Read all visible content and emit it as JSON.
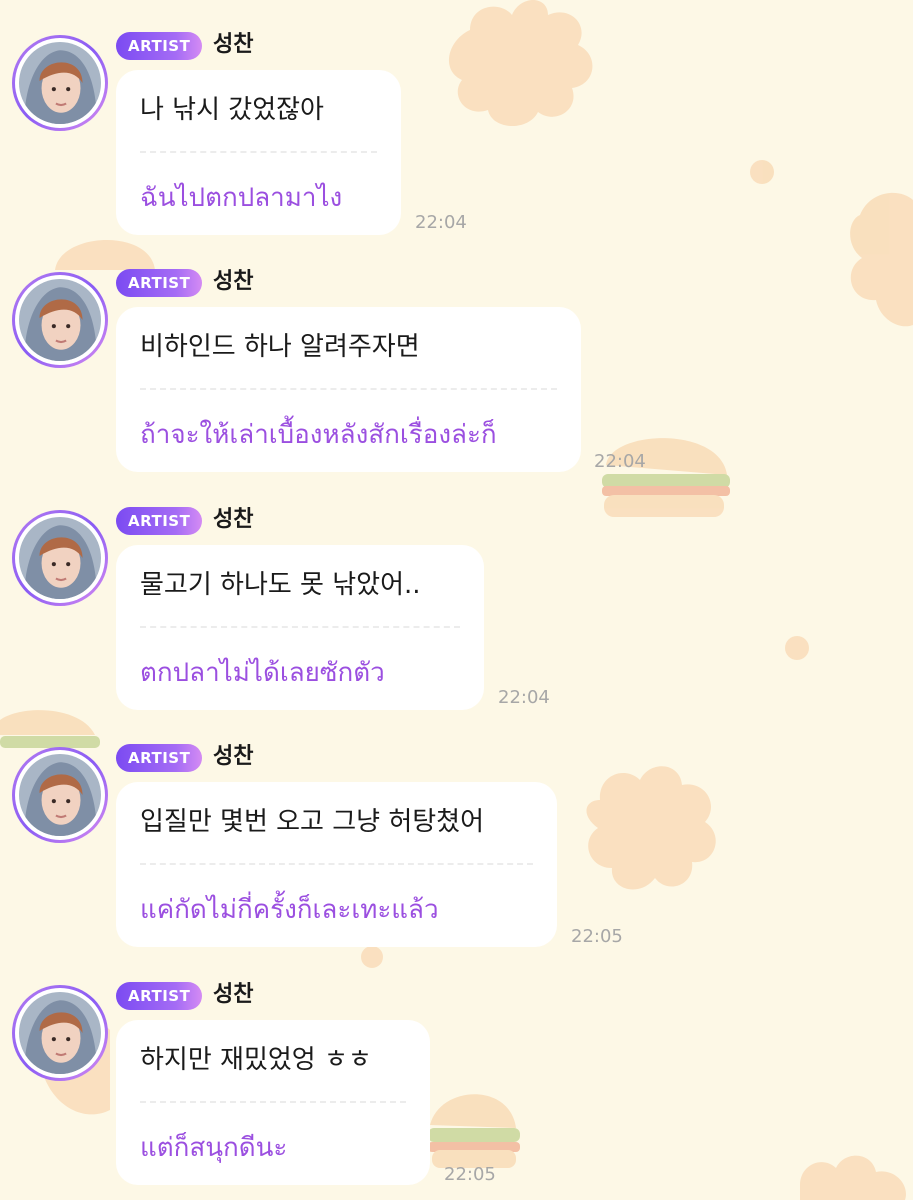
{
  "colors": {
    "background": "#fdf8e6",
    "badge_gradient_start": "#7b4bf2",
    "badge_gradient_end": "#d48bf3",
    "translation_text": "#9b4fe0",
    "timestamp": "#a7a7a7"
  },
  "messages": [
    {
      "badge": "ARTIST",
      "sender": "성찬",
      "avatar": "artist-avatar",
      "text": "나 낚시 갔었잖아",
      "translation": "ฉันไปตกปลามาไง",
      "time": "22:04"
    },
    {
      "badge": "ARTIST",
      "sender": "성찬",
      "avatar": "artist-avatar",
      "text": "비하인드 하나 알려주자면",
      "translation": "ถ้าจะให้เล่าเบื้องหลังสักเรื่องล่ะก็",
      "time": "22:04"
    },
    {
      "badge": "ARTIST",
      "sender": "성찬",
      "avatar": "artist-avatar",
      "text": "물고기 하나도 못 낚았어..",
      "translation": "ตกปลาไม่ได้เลยซักตัว",
      "time": "22:04"
    },
    {
      "badge": "ARTIST",
      "sender": "성찬",
      "avatar": "artist-avatar",
      "text": "입질만 몇번 오고 그냥 허탕쳤어",
      "translation": "แค่กัดไม่กี่ครั้งก็เละเทะแล้ว",
      "time": "22:05"
    },
    {
      "badge": "ARTIST",
      "sender": "성찬",
      "avatar": "artist-avatar",
      "text": "하지만 재밌었엉 ㅎㅎ",
      "translation": "แต่ก็สนุกดีนะ",
      "time": "22:05"
    }
  ]
}
